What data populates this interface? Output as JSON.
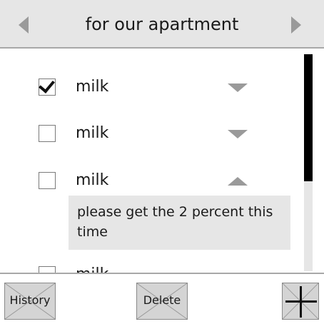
{
  "header": {
    "title": "for our apartment",
    "prev_icon": "chevron-left-icon",
    "next_icon": "chevron-right-icon"
  },
  "items": [
    {
      "label": "milk",
      "checked": true,
      "expanded": false
    },
    {
      "label": "milk",
      "checked": false,
      "expanded": false
    },
    {
      "label": "milk",
      "checked": false,
      "expanded": true,
      "note": "please get the 2 percent this time"
    },
    {
      "label": "milk",
      "checked": false,
      "expanded": false
    }
  ],
  "footer": {
    "history_label": "History",
    "delete_label": "Delete",
    "add_icon": "plus-icon"
  },
  "colors": {
    "header_bg": "#e6e6e6",
    "button_bg": "#d4d4d4",
    "icon_gray": "#9a9a9a",
    "scroll_thumb": "#000000"
  }
}
